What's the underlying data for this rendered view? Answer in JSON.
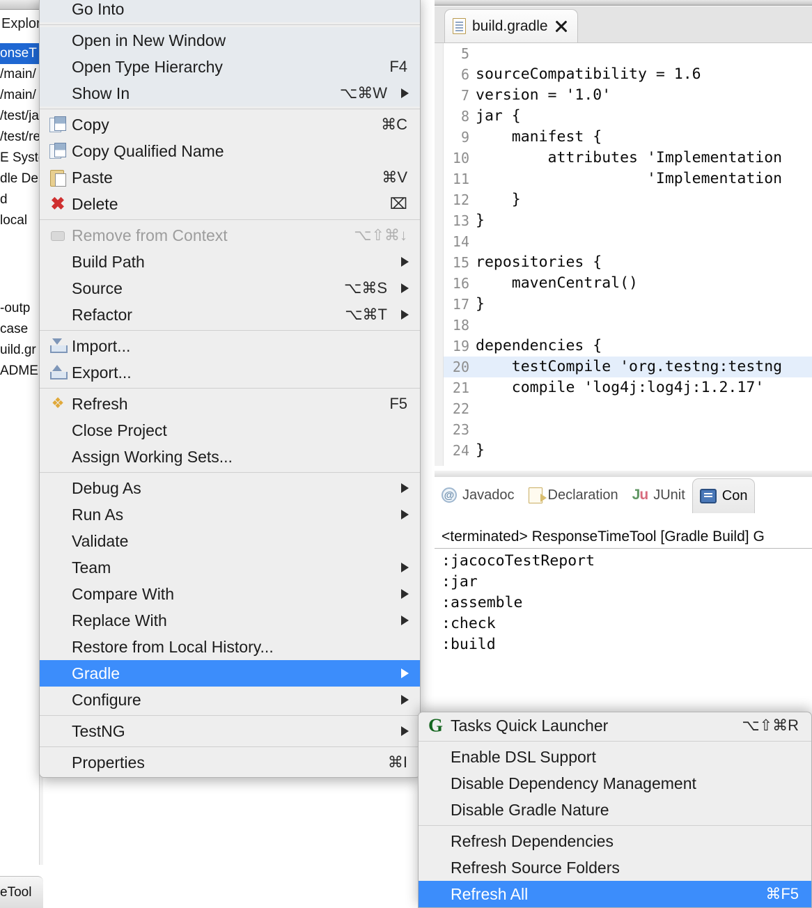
{
  "explorer": {
    "tab_label": "Explor",
    "items": [
      {
        "label": "onseT",
        "selected": true
      },
      {
        "label": "/main/",
        "selected": false
      },
      {
        "label": "/main/",
        "selected": false
      },
      {
        "label": "/test/ja",
        "selected": false
      },
      {
        "label": "/test/re",
        "selected": false
      },
      {
        "label": "E Syste",
        "selected": false
      },
      {
        "label": "dle De",
        "selected": false
      },
      {
        "label": "d",
        "selected": false
      },
      {
        "label": "local",
        "selected": false
      }
    ],
    "items2": [
      {
        "label": "-outp"
      },
      {
        "label": "case"
      },
      {
        "label": "uild.gr"
      },
      {
        "label": "ADME."
      }
    ],
    "bottom_tab_label": "eTool"
  },
  "editor": {
    "tab_label": "build.gradle",
    "file_icon": "file-icon",
    "close_icon": "close-icon",
    "lines": [
      {
        "num": "5",
        "text": "",
        "highlight": false
      },
      {
        "num": "6",
        "text": "sourceCompatibility = 1.6",
        "highlight": false
      },
      {
        "num": "7",
        "text": "version = '1.0'",
        "highlight": false
      },
      {
        "num": "8",
        "text": "jar {",
        "highlight": false
      },
      {
        "num": "9",
        "text": "    manifest {",
        "highlight": false
      },
      {
        "num": "10",
        "text": "        attributes 'Implementation",
        "highlight": false
      },
      {
        "num": "11",
        "text": "                   'Implementation",
        "highlight": false
      },
      {
        "num": "12",
        "text": "    }",
        "highlight": false
      },
      {
        "num": "13",
        "text": "}",
        "highlight": false
      },
      {
        "num": "14",
        "text": "",
        "highlight": false
      },
      {
        "num": "15",
        "text": "repositories {",
        "highlight": false
      },
      {
        "num": "16",
        "text": "    mavenCentral()",
        "highlight": false
      },
      {
        "num": "17",
        "text": "}",
        "highlight": false
      },
      {
        "num": "18",
        "text": "",
        "highlight": false
      },
      {
        "num": "19",
        "text": "dependencies {",
        "highlight": false
      },
      {
        "num": "20",
        "text": "    testCompile 'org.testng:testng",
        "highlight": true
      },
      {
        "num": "21",
        "text": "    compile 'log4j:log4j:1.2.17'",
        "highlight": false
      },
      {
        "num": "22",
        "text": "",
        "highlight": false
      },
      {
        "num": "23",
        "text": "",
        "highlight": false
      },
      {
        "num": "24",
        "text": "}",
        "highlight": false
      }
    ]
  },
  "views": {
    "tabs": [
      {
        "label": "Javadoc",
        "icon": "at-icon",
        "active": false
      },
      {
        "label": "Declaration",
        "icon": "declaration-icon",
        "active": false
      },
      {
        "label": "JUnit",
        "icon": "junit-icon",
        "active": false
      },
      {
        "label": "Con",
        "icon": "console-icon",
        "active": true
      }
    ],
    "console_title": "<terminated> ResponseTimeTool [Gradle Build] G",
    "console_output": ":jacocoTestReport\n:jar\n:assemble\n:check\n:build"
  },
  "context_menu": {
    "sections": [
      {
        "tinted": true,
        "items": [
          {
            "label": "Go Into",
            "accel": "",
            "arrow": false,
            "icon": "",
            "state": "normal"
          }
        ]
      },
      {
        "tinted": true,
        "items": [
          {
            "label": "Open in New Window",
            "accel": "",
            "arrow": false,
            "icon": "",
            "state": "normal"
          },
          {
            "label": "Open Type Hierarchy",
            "accel": "F4",
            "arrow": false,
            "icon": "",
            "state": "normal"
          },
          {
            "label": "Show In",
            "accel": "⌥⌘W",
            "arrow": true,
            "icon": "",
            "state": "normal"
          }
        ]
      },
      {
        "tinted": false,
        "items": [
          {
            "label": "Copy",
            "accel": "⌘C",
            "arrow": false,
            "icon": "copy-icon",
            "state": "normal"
          },
          {
            "label": "Copy Qualified Name",
            "accel": "",
            "arrow": false,
            "icon": "copy-qualified-icon",
            "state": "normal"
          },
          {
            "label": "Paste",
            "accel": "⌘V",
            "arrow": false,
            "icon": "paste-icon",
            "state": "normal"
          },
          {
            "label": "Delete",
            "accel": "⌧",
            "arrow": false,
            "icon": "delete-icon",
            "state": "normal"
          }
        ]
      },
      {
        "tinted": false,
        "items": [
          {
            "label": "Remove from Context",
            "accel": "⌥⇧⌘↓",
            "arrow": false,
            "icon": "remove-context-icon",
            "state": "disabled"
          },
          {
            "label": "Build Path",
            "accel": "",
            "arrow": true,
            "icon": "",
            "state": "normal"
          },
          {
            "label": "Source",
            "accel": "⌥⌘S",
            "arrow": true,
            "icon": "",
            "state": "normal"
          },
          {
            "label": "Refactor",
            "accel": "⌥⌘T",
            "arrow": true,
            "icon": "",
            "state": "normal"
          }
        ]
      },
      {
        "tinted": false,
        "items": [
          {
            "label": "Import...",
            "accel": "",
            "arrow": false,
            "icon": "import-icon",
            "state": "normal"
          },
          {
            "label": "Export...",
            "accel": "",
            "arrow": false,
            "icon": "export-icon",
            "state": "normal"
          }
        ]
      },
      {
        "tinted": false,
        "items": [
          {
            "label": "Refresh",
            "accel": "F5",
            "arrow": false,
            "icon": "refresh-icon",
            "state": "normal"
          },
          {
            "label": "Close Project",
            "accel": "",
            "arrow": false,
            "icon": "",
            "state": "normal"
          },
          {
            "label": "Assign Working Sets...",
            "accel": "",
            "arrow": false,
            "icon": "",
            "state": "normal"
          }
        ]
      },
      {
        "tinted": false,
        "items": [
          {
            "label": "Debug As",
            "accel": "",
            "arrow": true,
            "icon": "",
            "state": "normal"
          },
          {
            "label": "Run As",
            "accel": "",
            "arrow": true,
            "icon": "",
            "state": "normal"
          },
          {
            "label": "Validate",
            "accel": "",
            "arrow": false,
            "icon": "",
            "state": "normal"
          },
          {
            "label": "Team",
            "accel": "",
            "arrow": true,
            "icon": "",
            "state": "normal"
          },
          {
            "label": "Compare With",
            "accel": "",
            "arrow": true,
            "icon": "",
            "state": "normal"
          },
          {
            "label": "Replace With",
            "accel": "",
            "arrow": true,
            "icon": "",
            "state": "normal"
          },
          {
            "label": "Restore from Local History...",
            "accel": "",
            "arrow": false,
            "icon": "",
            "state": "normal"
          },
          {
            "label": "Gradle",
            "accel": "",
            "arrow": true,
            "icon": "",
            "state": "selected"
          },
          {
            "label": "Configure",
            "accel": "",
            "arrow": true,
            "icon": "",
            "state": "normal"
          }
        ]
      },
      {
        "tinted": false,
        "items": [
          {
            "label": "TestNG",
            "accel": "",
            "arrow": true,
            "icon": "",
            "state": "normal"
          }
        ]
      },
      {
        "tinted": false,
        "items": [
          {
            "label": "Properties",
            "accel": "⌘I",
            "arrow": false,
            "icon": "",
            "state": "normal"
          }
        ]
      }
    ]
  },
  "gradle_submenu": {
    "sections": [
      {
        "items": [
          {
            "label": "Tasks Quick Launcher",
            "accel": "⌥⇧⌘R",
            "icon": "gradle-g-icon",
            "state": "normal"
          }
        ]
      },
      {
        "items": [
          {
            "label": "Enable DSL Support",
            "accel": "",
            "icon": "",
            "state": "normal"
          },
          {
            "label": "Disable Dependency Management",
            "accel": "",
            "icon": "",
            "state": "normal"
          },
          {
            "label": "Disable Gradle Nature",
            "accel": "",
            "icon": "",
            "state": "normal"
          }
        ]
      },
      {
        "items": [
          {
            "label": "Refresh Dependencies",
            "accel": "",
            "icon": "",
            "state": "normal"
          },
          {
            "label": "Refresh Source Folders",
            "accel": "",
            "icon": "",
            "state": "normal"
          },
          {
            "label": "Refresh All",
            "accel": "⌘F5",
            "icon": "",
            "state": "selected"
          }
        ]
      }
    ]
  },
  "colors": {
    "selection_blue": "#3c8dfb",
    "tree_selection_blue": "#1f67d2",
    "line_highlight": "#e4eefb",
    "menu_bg": "#eeeeee",
    "gradle_green": "#14651f"
  }
}
